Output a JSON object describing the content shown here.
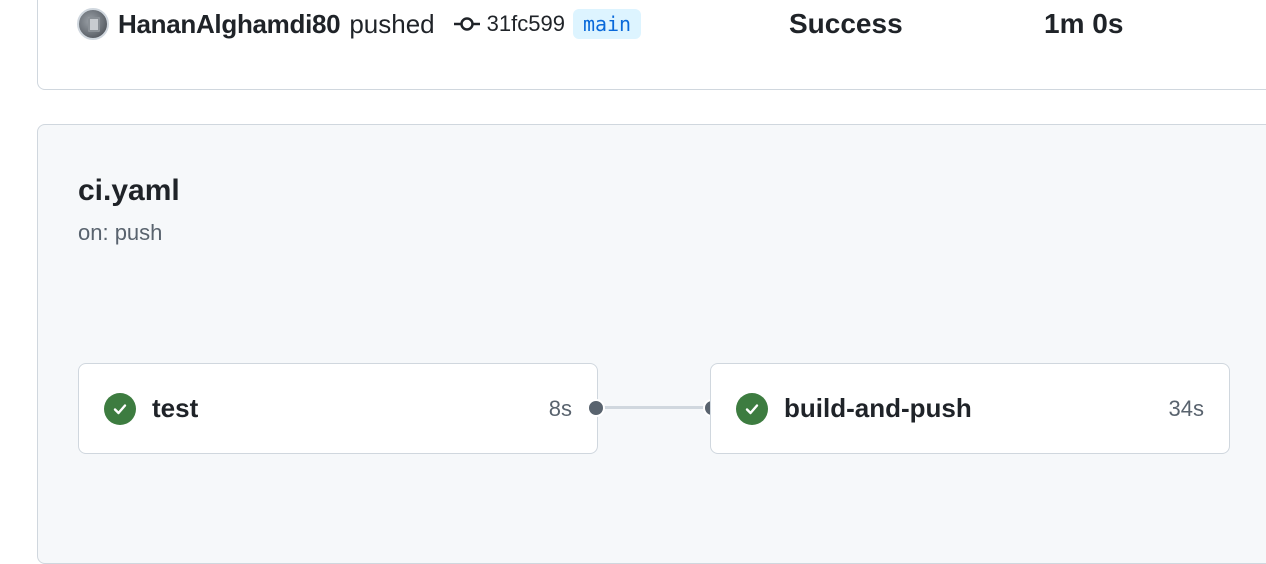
{
  "run": {
    "actor": "HananAlghamdi80",
    "action": "pushed",
    "commit_sha": "31fc599",
    "branch": "main",
    "status": "Success",
    "duration": "1m 0s"
  },
  "workflow": {
    "file": "ci.yaml",
    "trigger": "on: push",
    "jobs": [
      {
        "name": "test",
        "time": "8s",
        "status_icon": "check-circle-icon",
        "status_color": "#3d7c40"
      },
      {
        "name": "build-and-push",
        "time": "34s",
        "status_icon": "check-circle-icon",
        "status_color": "#3d7c40"
      }
    ]
  },
  "colors": {
    "branch_bg": "#ddf4ff",
    "branch_text": "#0969da",
    "success": "#3d7c40",
    "panel_bg": "#f6f8fa",
    "border": "#d0d7de"
  }
}
